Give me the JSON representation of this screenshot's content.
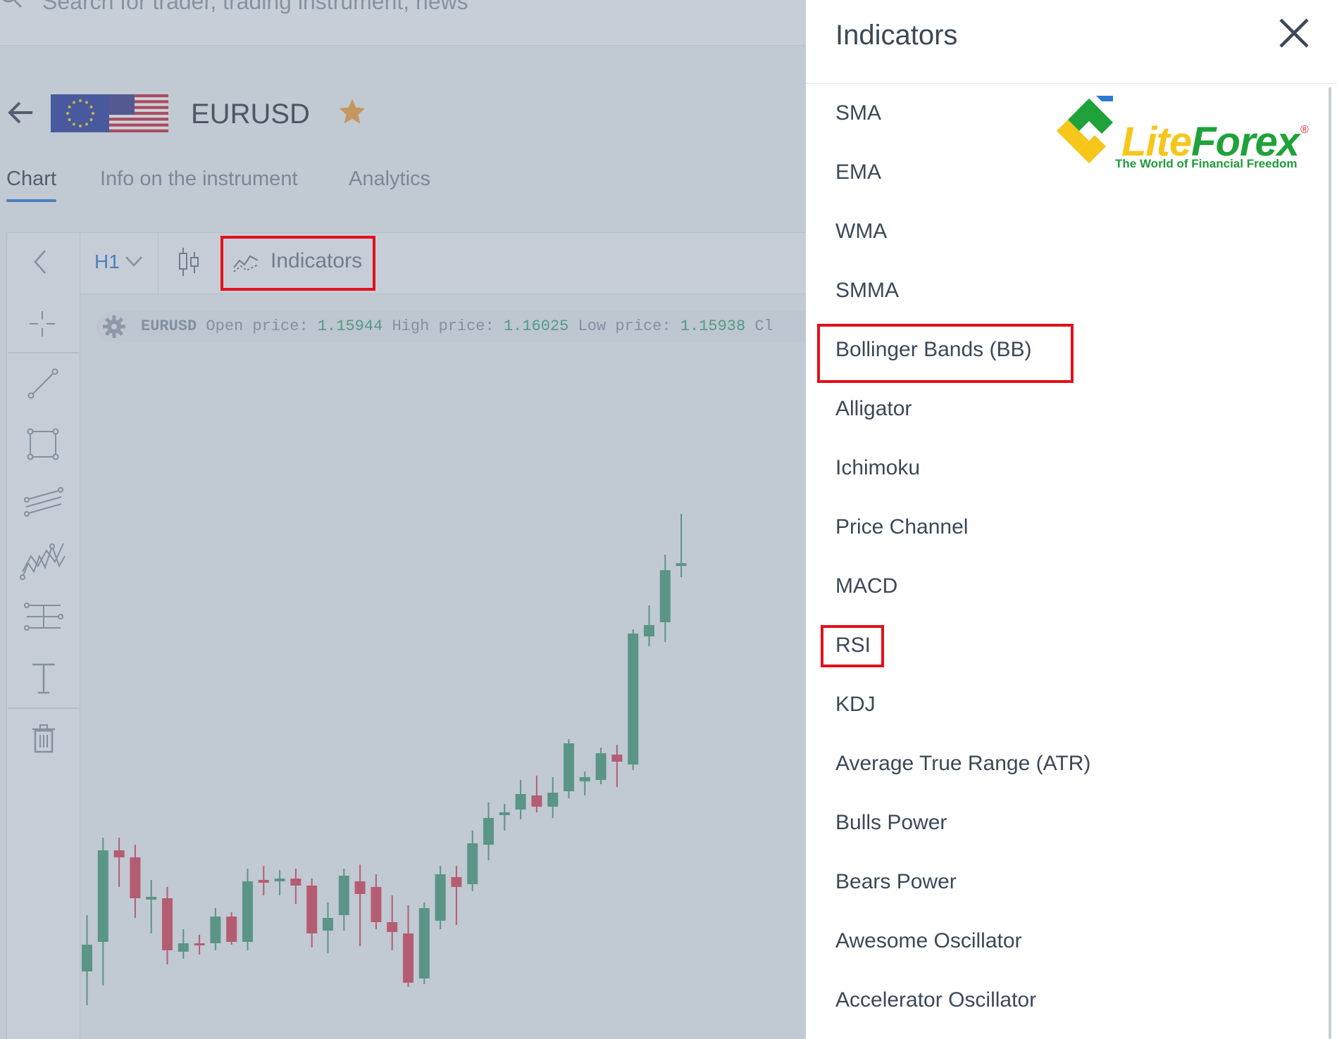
{
  "search": {
    "placeholder_text": "Search for trader, trading instrument, news"
  },
  "instrument": {
    "symbol": "EURUSD",
    "favorite": true
  },
  "tabs": [
    {
      "label": "Chart",
      "active": true
    },
    {
      "label": "Info on the instrument",
      "active": false
    },
    {
      "label": "Analytics",
      "active": false
    }
  ],
  "toolbar": {
    "timeframe": "H1",
    "indicators_label": "Indicators"
  },
  "info_bar": {
    "symbol": "EURUSD",
    "open_label": "Open price:",
    "open_value": "1.15944",
    "high_label": "High price:",
    "high_value": "1.16025",
    "low_label": "Low price:",
    "low_value": "1.15938",
    "close_label": "Cl"
  },
  "drawing_tools": [
    "crosshair-icon",
    "line-icon",
    "rectangle-icon",
    "channel-icon",
    "pattern-icon",
    "fibonacci-icon",
    "text-icon",
    "trash-icon"
  ],
  "chart_data": {
    "type": "candlestick",
    "candle_colors": {
      "up": "#4a9e78",
      "down": "#d9445a"
    }
  },
  "panel": {
    "title": "Indicators",
    "items": [
      "SMA",
      "EMA",
      "WMA",
      "SMMA",
      "Bollinger Bands (BB)",
      "Alligator",
      "Ichimoku",
      "Price Channel",
      "MACD",
      "RSI",
      "KDJ",
      "Average True Range (ATR)",
      "Bulls Power",
      "Bears Power",
      "Awesome Oscillator",
      "Accelerator Oscillator"
    ],
    "highlighted": [
      "Bollinger Bands (BB)",
      "RSI"
    ]
  },
  "logo": {
    "part1": "Lite",
    "part2": "Forex",
    "registered": "®",
    "tagline": "The World of Financial Freedom"
  },
  "colors": {
    "accent": "#2f7bd0",
    "highlight_box": "#e3101b",
    "up_candle": "#4a9e78",
    "down_candle": "#d9445a"
  }
}
